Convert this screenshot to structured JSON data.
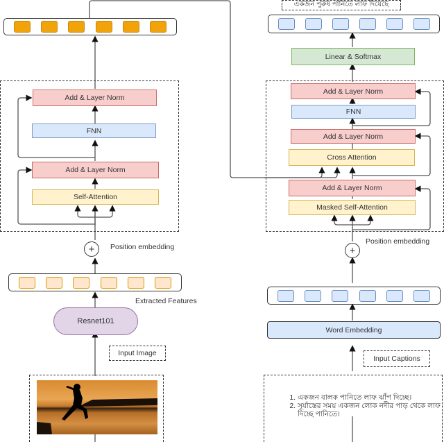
{
  "encoder": {
    "output_cells": 6,
    "add_norm_top": "Add & Layer Norm",
    "fnn": "FNN",
    "add_norm_bottom": "Add & Layer Norm",
    "self_attention": "Self-Attention",
    "position_embedding": "Position embedding",
    "feature_cells": 6,
    "extracted_features": "Extracted Features",
    "resnet": "Resnet101",
    "input_image": "Input Image",
    "image_description": "silhouette of a person jumping at sunset over water"
  },
  "decoder": {
    "output_caption": "একজন পুরুষ পানিতে লাফ দিয়েছে",
    "output_cells": 6,
    "linear_softmax": "Linear & Softmax",
    "add_norm_top": "Add & Layer Norm",
    "fnn": "FNN",
    "add_norm_mid": "Add & Layer Norm",
    "cross_attention": "Cross Attention",
    "add_norm_bottom": "Add & Layer Norm",
    "masked_self_attention": "Masked Self-Attention",
    "position_embedding": "Position embedding",
    "embedding_cells": 6,
    "word_embedding": "Word Embedding",
    "input_captions": "Input Captions",
    "captions": [
      "একজন বালক পানিতে লাফ ঝাঁপ দিচ্ছে।",
      "সূর্যাস্তের সময় একজন লোক নদীর পাড় থেকে লাফ দিচ্ছে পানিতে।"
    ]
  },
  "colors": {
    "norm": "#f8cecc",
    "fnn": "#dae8fc",
    "attention": "#fff2cc",
    "linear": "#d5e8d4",
    "resnet": "#e1d5e7",
    "encoder_output": "#f0a30a",
    "features": "#ffe6cc"
  }
}
